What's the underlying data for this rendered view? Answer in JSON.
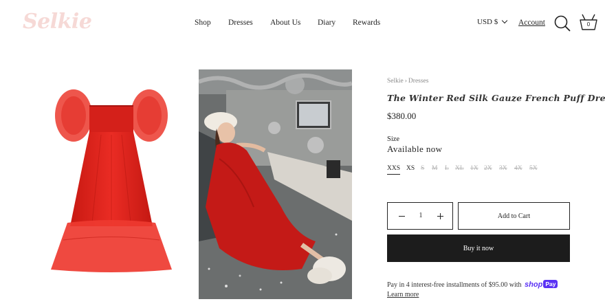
{
  "header": {
    "logo": "Selkie",
    "nav": [
      "Shop",
      "Dresses",
      "About Us",
      "Diary",
      "Rewards"
    ],
    "currency": "USD $",
    "account": "Account",
    "cart_count": "0"
  },
  "product": {
    "breadcrumb": [
      "Selkie",
      "Dresses"
    ],
    "breadcrumb_sep": "›",
    "title": "The Winter Red Silk Gauze French Puff Dress",
    "price": "$380.00",
    "size_label": "Size",
    "availability": "Available now",
    "sizes": [
      {
        "label": "XXS",
        "state": "selected"
      },
      {
        "label": "XS",
        "state": "available"
      },
      {
        "label": "S",
        "state": "sold-out"
      },
      {
        "label": "M",
        "state": "sold-out"
      },
      {
        "label": "L",
        "state": "sold-out"
      },
      {
        "label": "XL",
        "state": "sold-out"
      },
      {
        "label": "1X",
        "state": "sold-out"
      },
      {
        "label": "2X",
        "state": "sold-out"
      },
      {
        "label": "3X",
        "state": "sold-out"
      },
      {
        "label": "4X",
        "state": "sold-out"
      },
      {
        "label": "5X",
        "state": "sold-out"
      }
    ],
    "quantity": "1",
    "add_to_cart": "Add to Cart",
    "buy_now": "Buy it now",
    "installments_text": "Pay in 4 interest-free installments of $95.00 with",
    "shop_pay_shop": "shop",
    "shop_pay_pay": "Pay",
    "learn_more": "Learn more"
  },
  "colors": {
    "logo": "#f6d9d6",
    "dress_red": "#e0241f",
    "buy_button": "#1c1c1c",
    "shop_pay": "#5a31f4"
  },
  "icons": [
    "search-icon",
    "cart-icon",
    "chevron-down-icon",
    "minus-icon",
    "plus-icon"
  ]
}
